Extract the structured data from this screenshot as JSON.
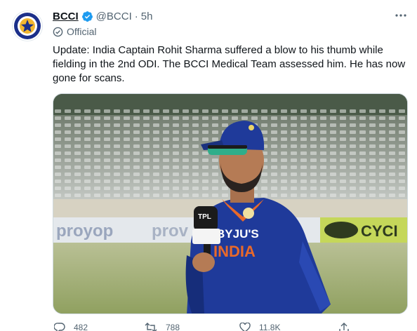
{
  "account": {
    "name": "BCCI",
    "handle": "@BCCI",
    "separator": "·",
    "time": "5h",
    "label": "Official"
  },
  "tweet": {
    "text": "Update: India Captain Rohit Sharma suffered a blow to his thumb while fielding in the 2nd ODI. The BCCI Medical Team assessed him. He has now gone for scans."
  },
  "media": {
    "board_left": "proyop",
    "board_mid": "prov",
    "board_right": "CYCI",
    "jersey_sponsor": "BYJU'S",
    "jersey_team": "INDIA",
    "mic_flag_text": "TPL"
  },
  "actions": {
    "reply_count": "482",
    "retweet_count": "788",
    "like_count": "11.8K"
  },
  "colors": {
    "verified": "#1d9bf0",
    "text": "#0f1419",
    "secondary": "#536471",
    "jersey": "#1f3a9a",
    "jersey_accent": "#e8692a"
  }
}
